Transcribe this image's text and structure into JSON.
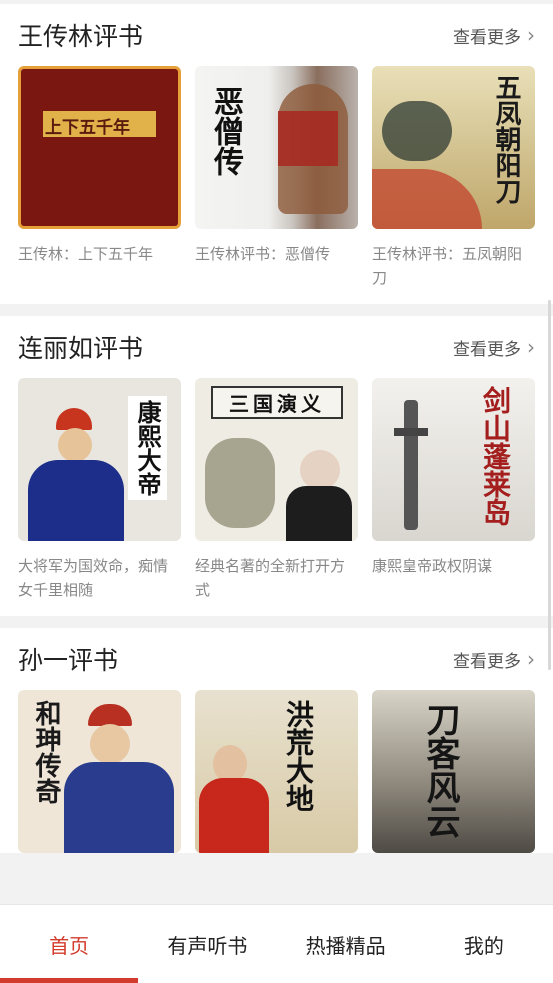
{
  "sections": [
    {
      "title": "王传林评书",
      "more_label": "查看更多",
      "items": [
        {
          "caption": "王传林：上下五千年",
          "cover_text": "上下五千年"
        },
        {
          "caption": "王传林评书：恶僧传",
          "cover_text": "恶僧传"
        },
        {
          "caption": "王传林评书：五凤朝阳刀",
          "cover_text": "五凤朝阳刀"
        }
      ]
    },
    {
      "title": "连丽如评书",
      "more_label": "查看更多",
      "items": [
        {
          "caption": "大将军为国效命，痴情女千里相随",
          "cover_text": "康熙大帝"
        },
        {
          "caption": "经典名著的全新打开方式",
          "cover_text": "三国演义"
        },
        {
          "caption": "康熙皇帝政权阴谋",
          "cover_text": "剑山蓬莱岛"
        }
      ]
    },
    {
      "title": "孙一评书",
      "more_label": "查看更多",
      "items": [
        {
          "caption": "",
          "cover_text": "和珅传奇"
        },
        {
          "caption": "",
          "cover_text": "洪荒大地"
        },
        {
          "caption": "",
          "cover_text": "刀客风云"
        }
      ]
    }
  ],
  "tabs": [
    {
      "label": "首页",
      "active": true
    },
    {
      "label": "有声听书",
      "active": false
    },
    {
      "label": "热播精品",
      "active": false
    },
    {
      "label": "我的",
      "active": false
    }
  ],
  "accent_color": "#d33b2c"
}
